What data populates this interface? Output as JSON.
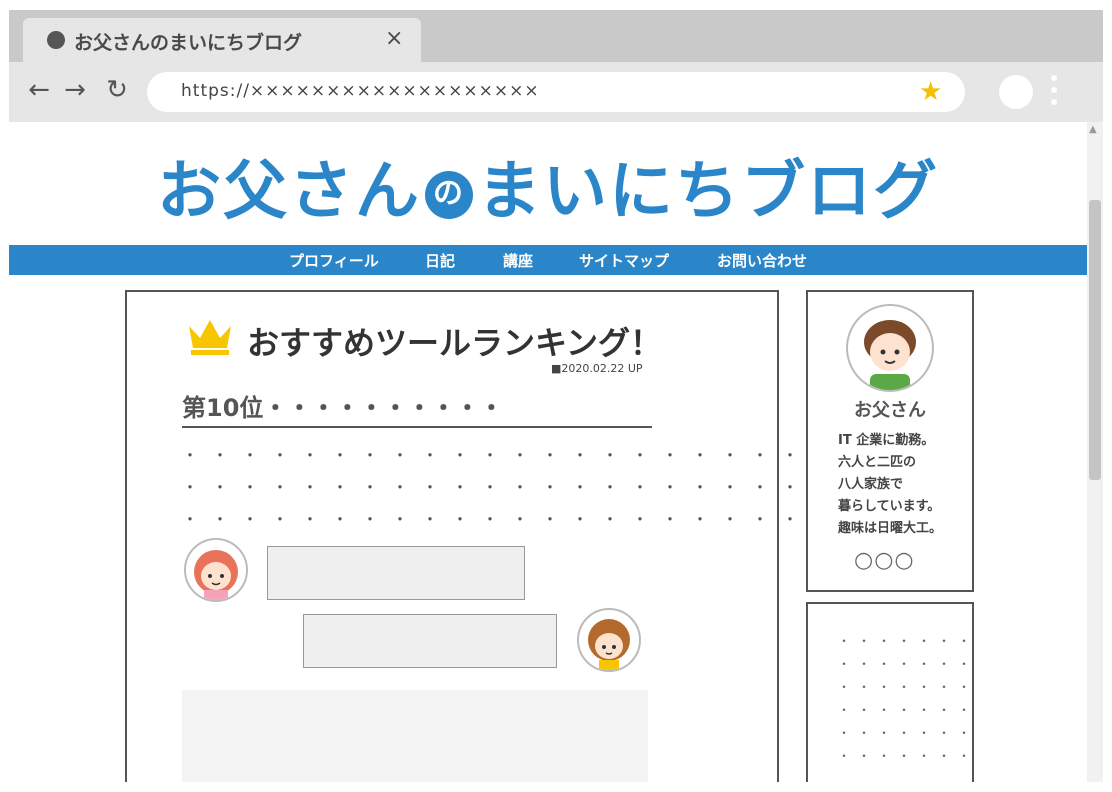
{
  "browser": {
    "tab_title": "お父さんのまいにちブログ",
    "tab_close": "×",
    "url": "https://×××××××××××××××××××",
    "nav_back": "←",
    "nav_forward": "→",
    "nav_reload": "↻",
    "star": "★"
  },
  "site": {
    "logo_left": "お父さん",
    "logo_no": "の",
    "logo_right": "まいにちブログ",
    "nav": [
      "プロフィール",
      "日記",
      "講座",
      "サイトマップ",
      "お問い合わせ"
    ]
  },
  "article": {
    "title": "おすすめツールランキング！",
    "date": "■2020.02.22 UP",
    "rank_heading": "第10位・・・・・・・・・・",
    "dot_lines": [
      "・・・・・・・・・・・・・・・・・・・・・・・・",
      "・・・・・・・・・・・・・・・・・・・・・・・・",
      "・・・・・・・・・・・・・・・・・・・・・・"
    ]
  },
  "sidebar": {
    "profile_name": "お父さん",
    "bio": [
      "IT 企業に勤務。",
      "六人と二匹の",
      "八人家族で",
      "暮らしています。",
      "趣味は日曜大工。"
    ],
    "circles": "○○○",
    "widget_dots": [
      "・・・・・・・",
      "・・・・・・・",
      "・・・・・・・",
      "・・・・・・・",
      "・・・・・・・",
      "・・・・・・・"
    ]
  },
  "colors": {
    "brand_blue": "#2a86c9",
    "crown_yellow": "#f7c600",
    "tabbar_gray": "#c9c9c9",
    "toolbar_gray": "#e6e6e6"
  },
  "icons": [
    "tab-dot-icon",
    "close-icon",
    "back-arrow-icon",
    "forward-arrow-icon",
    "reload-icon",
    "star-icon",
    "profile-icon",
    "menu-dots-icon",
    "crown-icon"
  ]
}
